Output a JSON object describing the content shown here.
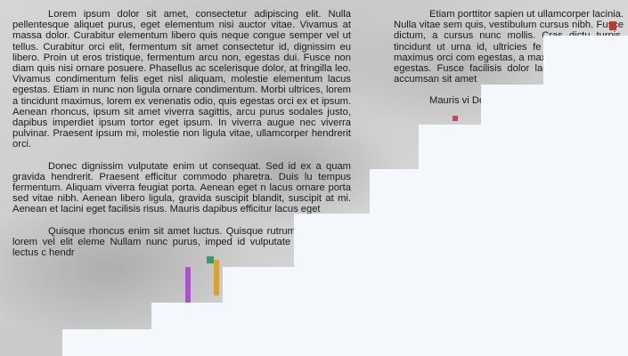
{
  "left_column": {
    "paragraphs": [
      "Lorem ipsum dolor sit amet, consectetur adipiscing elit. Nulla pellentesque aliquet purus, eget elementum nisi auctor vitae. Vivamus at massa dolor. Curabitur elementum libero quis neque congue semper vel ut tellus. Curabitur orci elit, fermentum sit amet consectetur id, dignissim eu libero. Proin ut eros tristique, fermentum arcu non, egestas dui. Fusce non diam quis nisi ornare posuere. Phasellus ac scelerisque dolor, at fringilla leo. Vivamus condimentum felis eget nisl aliquam, molestie elementum lacus egestas. Etiam in nunc non ligula ornare condimentum. Morbi ultrices, lorem a tincidunt maximus, lorem ex venenatis odio, quis egestas orci ex et ipsum. Aenean rhoncus, ipsum sit amet viverra sagittis, arcu purus sodales justo, dapibus imperdiet ipsum tortor eget ipsum. In viverra augue nec viverra pulvinar. Praesent ipsum mi, molestie non ligula vitae, ullamcorper hendrerit orci.",
      "Donec dignissim vulputate enim ut consequat. Sed id ex a quam gravida hendrerit. Praesent efficitur commodo pharetra. Duis lu tempus fermentum. Aliquam viverra feugiat porta. Aenean eget n lacus ornare porta sed vitae nibh. Aenean libero ligula, gravida suscipit blandit, suscipit at mi. Aenean et lacini eget facilisis risus. Mauris dapibus efficitur lacus eget",
      "Quisque rhoncus enim sit amet luctus. Quisque rutrum sem finibus lorem vel elit eleme Nullam nunc purus, imped id vulputate dolor, iac ut lectus c hendr"
    ]
  },
  "right_column": {
    "paragraphs": [
      "Etiam porttitor sapien ut ullamcorper lacinia. Nulla vitae sem quis, vestibulum cursus nibh. Fusce dictum, a cursus nunc mollis. Cras dictu turpis, tincidunt ut urna id, ultricies fe sollicitudin mi, a maximus orci com egestas, a maximus nisi pulvinar egestas. Fusce facilisis dolor lacus. Suspendisse accumsan sit amet",
      "Mauris vi Donec Nulla"
    ]
  }
}
